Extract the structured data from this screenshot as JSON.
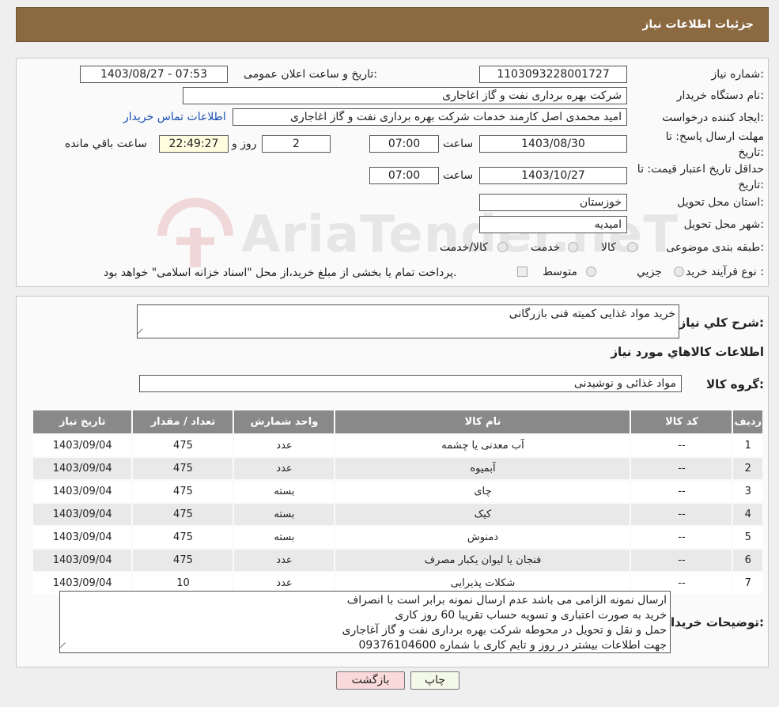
{
  "header": {
    "title": "جزئیات اطلاعات نیاز"
  },
  "form": {
    "need_number_label": "شماره نیاز:",
    "need_number": "1103093228001727",
    "announce_label": "تاریخ و ساعت اعلان عمومی:",
    "announce_value": "1403/08/27 - 07:53",
    "buyer_org_label": "نام دستگاه خریدار:",
    "buyer_org": "شرکت بهره برداری نفت و گاز اغاجاری",
    "requester_label": "ایجاد کننده درخواست:",
    "requester": "امید محمدی اصل کارمند خدمات شرکت بهره برداری نفت و گاز اغاجاری",
    "contact_link": "اطلاعات تماس خریدار",
    "deadline_label": "مهلت ارسال پاسخ: تا تاریخ:",
    "deadline_date": "1403/08/30",
    "time_label": "ساعت",
    "deadline_time": "07:00",
    "days_value": "2",
    "days_label": "روز و",
    "remaining_time": "22:49:27",
    "remaining_label": "ساعت باقي مانده",
    "validity_label": "حداقل تاریخ اعتبار قیمت: تا تاریخ:",
    "validity_date": "1403/10/27",
    "validity_time": "07:00",
    "province_label": "استان محل تحویل:",
    "province": "خوزستان",
    "city_label": "شهر محل تحویل:",
    "city": "امیدیه",
    "category_label": "طبقه بندی موضوعی:",
    "category_options": [
      "کالا",
      "خدمت",
      "کالا/خدمت"
    ],
    "process_label": "نوع فرآیند خرید :",
    "process_options": [
      "جزیي",
      "متوسط"
    ],
    "process_note": "پرداخت تمام یا بخشی از مبلغ خرید،از محل \"اسناد خزانه اسلامی\" خواهد بود."
  },
  "summary": {
    "desc_label": "شرح کلي نياز:",
    "desc_value": "خرید مواد غذایی کمیته فنی بازرگانی",
    "items_title": "اطلاعات کالاهاي مورد نياز",
    "group_label": "گروه کالا:",
    "group_value": "مواد غذائی و نوشیدنی"
  },
  "table": {
    "headers": [
      "ردیف",
      "کد کالا",
      "نام کالا",
      "واحد شمارش",
      "تعداد / مقدار",
      "تاریخ نیاز"
    ],
    "rows": [
      [
        "1",
        "--",
        "آب معدنی یا چشمه",
        "عدد",
        "475",
        "1403/09/04"
      ],
      [
        "2",
        "--",
        "آبمیوه",
        "عدد",
        "475",
        "1403/09/04"
      ],
      [
        "3",
        "--",
        "چای",
        "بسته",
        "475",
        "1403/09/04"
      ],
      [
        "4",
        "--",
        "کیک",
        "بسته",
        "475",
        "1403/09/04"
      ],
      [
        "5",
        "--",
        "دمنوش",
        "بسته",
        "475",
        "1403/09/04"
      ],
      [
        "6",
        "--",
        "فنجان یا لیوان یکبار مصرف",
        "عدد",
        "475",
        "1403/09/04"
      ],
      [
        "7",
        "--",
        "شکلات پذیرایی",
        "عدد",
        "10",
        "1403/09/04"
      ]
    ]
  },
  "notes": {
    "label": "توضیحات خریدار:",
    "lines": [
      "ارسال نمونه الزامی می باشد عدم ارسال نمونه برابر است با انصراف",
      "خرید به صورت اعتباری و تسویه حساب تقریبا  60 روز کاری",
      "حمل و نقل و تحویل در محوطه  شرکت بهره برداری نفت و گاز آغاجاری",
      "جهت اطلاعات بیشتر در روز و تایم کاری با شماره 09376104600"
    ]
  },
  "buttons": {
    "print": "چاپ",
    "back": "بازگشت"
  },
  "watermark": {
    "text": "AriaTender.neT"
  },
  "colors": {
    "header_bg": "#8b6a42",
    "table_header": "#898989",
    "link": "#1a4fb4",
    "back_btn": "#f9d9d9"
  }
}
